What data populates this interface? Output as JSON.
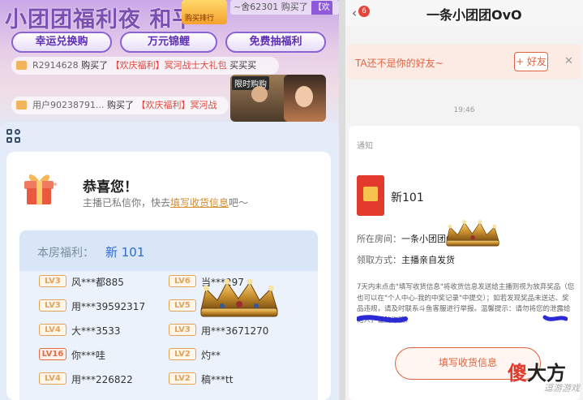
{
  "left": {
    "banner": {
      "title": "小团团福利夜 和平",
      "prize_box_label": "购买排行",
      "top_ticker_text": "~舍62301 购买了",
      "top_ticker_tag": "【欢"
    },
    "buttons": [
      "幸运兑换购",
      "万元锦鲤",
      "免费抽福利"
    ],
    "tickers": [
      {
        "user": "R2914628",
        "verb": "购买了",
        "item": "【欢庆福利】冥河战士大礼包",
        "tail": "买买买"
      },
      {
        "user": "用户90238791...",
        "verb": "购买了",
        "item": "【欢庆福利】冥河战",
        "tail": ""
      }
    ],
    "limited_label": "限时购购",
    "congrats_title": "恭喜您！",
    "congrats_sub_before": "主播已私信你，快去",
    "congrats_sub_link": "填写收货信息",
    "congrats_sub_after": "吧～",
    "welfare_label": "本房福利：",
    "welfare_value": "新 101",
    "winners": [
      {
        "level": "LV3",
        "name": "风***都885"
      },
      {
        "level": "LV6",
        "name": "当***297"
      },
      {
        "level": "LV3",
        "name": "用***39592317"
      },
      {
        "level": "LV5",
        "name": ""
      },
      {
        "level": "LV4",
        "name": "大***3533"
      },
      {
        "level": "LV3",
        "name": "用***3671270"
      },
      {
        "level": "LV16",
        "name": "你***哇"
      },
      {
        "level": "LV2",
        "name": "灼**"
      },
      {
        "level": "LV4",
        "name": "用***226822"
      },
      {
        "level": "LV2",
        "name": "稿***tt"
      }
    ]
  },
  "right": {
    "badge": "6",
    "chat_title": "一条小团团OvO",
    "not_friend_text": "TA还不是你的好友~",
    "add_friend_button": "+ 好友",
    "close_label": "✕",
    "time": "19:46",
    "notice_label": "通知",
    "prize_name": "新101",
    "room_label": "所在房间：",
    "room_value": "一条小团团OvO",
    "claim_label": "领取方式：",
    "claim_value": "主播亲自发货",
    "paragraph": "7天内未点击\"填写收货信息\"将收货信息发送给主播则视为放弃奖品（您也可以在\"个人中心-我的中奖记录\"中提交）；如若发现奖品未送达、奖品违规，请及时联系斗鱼客服进行举报。温馨提示：请勿将您的",
    "paragraph_tail": "泄露给他人，谨防诈骗。",
    "fill_button": "填写收货信息"
  },
  "watermark": {
    "red": "傻",
    "black": "大方",
    "sub": "逗游游戏"
  },
  "colors": {
    "accent_orange": "#e0643f",
    "primary_purple": "#8b63d3",
    "welfare_blue": "#2f6bcc",
    "level_orange": "#e3a25c",
    "gift_red": "#e23b2e"
  },
  "icons": [
    "gift-icon",
    "grid-icon",
    "crown-icon",
    "back-icon",
    "close-icon",
    "speaker-icon",
    "red-envelope-icon"
  ]
}
